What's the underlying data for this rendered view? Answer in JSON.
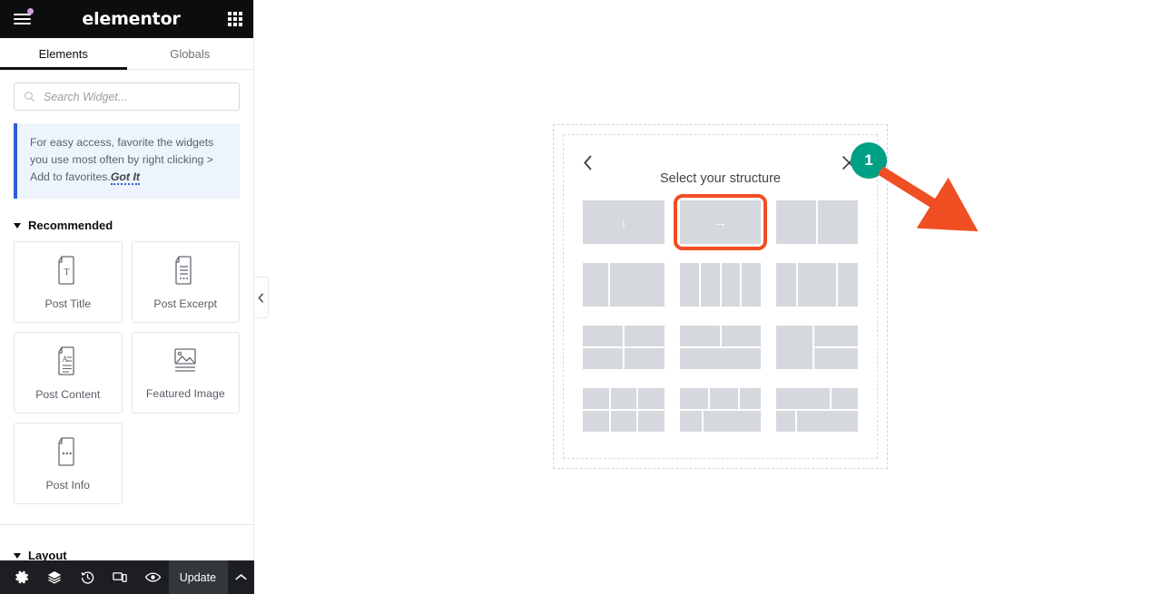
{
  "header": {
    "brand": "elementor",
    "menu_icon": "hamburger-menu-icon",
    "apps_icon": "apps-grid-icon"
  },
  "tabs": [
    {
      "label": "Elements",
      "active": true
    },
    {
      "label": "Globals",
      "active": false
    }
  ],
  "search": {
    "placeholder": "Search Widget...",
    "value": "",
    "icon": "search-icon"
  },
  "notice": {
    "text": "For easy access, favorite the widgets you use most often by right clicking > Add to favorites.",
    "link_label": "Got It",
    "accent_color": "#2e5fd6",
    "background_color": "#eef4fd"
  },
  "sections": [
    {
      "title": "Recommended",
      "expanded": true,
      "widgets": [
        {
          "label": "Post Title",
          "icon": "post-title-icon"
        },
        {
          "label": "Post Excerpt",
          "icon": "post-excerpt-icon"
        },
        {
          "label": "Post Content",
          "icon": "post-content-icon"
        },
        {
          "label": "Featured Image",
          "icon": "featured-image-icon"
        },
        {
          "label": "Post Info",
          "icon": "post-info-icon"
        }
      ]
    },
    {
      "title": "Layout",
      "expanded": true,
      "widgets": []
    }
  ],
  "collapse_handle": {
    "icon": "chevron-left-icon"
  },
  "bottom_bar": {
    "icons": [
      {
        "name": "settings-gear-icon"
      },
      {
        "name": "navigator-layers-icon"
      },
      {
        "name": "history-clock-icon"
      },
      {
        "name": "responsive-devices-icon"
      },
      {
        "name": "preview-eye-icon"
      }
    ],
    "update_label": "Update",
    "expand_icon": "chevron-up-icon"
  },
  "structure_panel": {
    "title": "Select your structure",
    "back_icon": "chevron-left-icon",
    "close_icon": "close-x-icon",
    "presets": [
      {
        "name": "single-column-down",
        "type": "arrow",
        "arrow": "↓",
        "selected": false
      },
      {
        "name": "single-column-right",
        "type": "arrow",
        "arrow": "→",
        "selected": true
      },
      {
        "name": "two-columns-equal",
        "type": "cols",
        "cols": [
          1,
          1
        ],
        "selected": false
      },
      {
        "name": "two-columns-33-66",
        "type": "cols",
        "cols": [
          1,
          2
        ],
        "selected": false
      },
      {
        "name": "four-columns-equal",
        "type": "cols",
        "cols": [
          1,
          1,
          1,
          1
        ],
        "selected": false
      },
      {
        "name": "three-columns-25-50-25",
        "type": "cols",
        "cols": [
          1,
          2,
          1
        ],
        "selected": false
      },
      {
        "name": "grid-two-by-two",
        "type": "grid22",
        "selected": false
      },
      {
        "name": "two-top-one-bottom",
        "type": "two-top-one-bottom",
        "selected": false
      },
      {
        "name": "left-full-two-right",
        "type": "left-full-two-right",
        "selected": false
      },
      {
        "name": "grid-three-by-two",
        "type": "grid32",
        "selected": false
      },
      {
        "name": "three-top-two-bottom",
        "type": "three-top-two-bottom",
        "selected": false
      },
      {
        "name": "two-top-two-bottom-offset",
        "type": "two-top-two-bottom-offset",
        "selected": false
      }
    ]
  },
  "annotation": {
    "step_number": "1",
    "badge_color": "#00a085",
    "arrow_color": "#f04e23",
    "highlight_color": "#f04e23"
  }
}
